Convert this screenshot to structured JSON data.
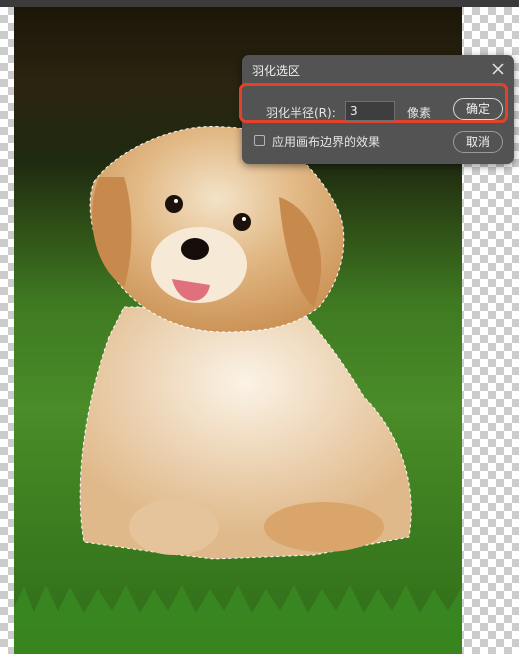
{
  "dialog": {
    "title": "羽化选区",
    "radius_label": "羽化半径(R):",
    "radius_value": "3",
    "unit_label": "像素",
    "ok_label": "确定",
    "cancel_label": "取消",
    "checkbox_label": "应用画布边界的效果",
    "checkbox_checked": false,
    "close_icon": "close-icon"
  },
  "colors": {
    "dialog_bg": "#535353",
    "highlight": "#e4412b",
    "canvas_dark": "#2a2a2a"
  }
}
